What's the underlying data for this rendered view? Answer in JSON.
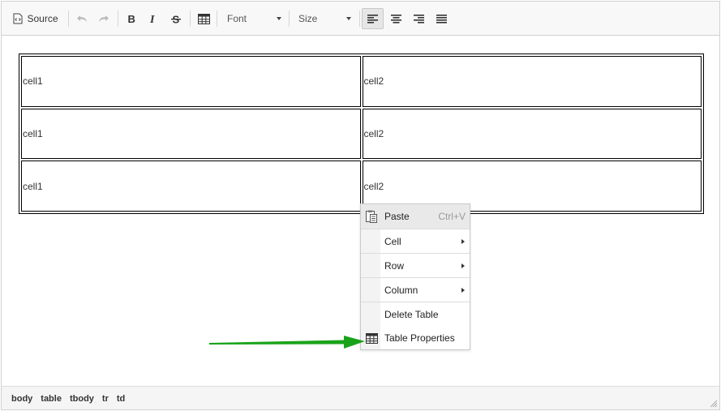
{
  "toolbar": {
    "source_label": "Source",
    "font_label": "Font",
    "size_label": "Size"
  },
  "table": {
    "rows": [
      [
        "cell1",
        "cell2"
      ],
      [
        "cell1",
        "cell2"
      ],
      [
        "cell1",
        "cell2"
      ]
    ]
  },
  "context_menu": {
    "paste_label": "Paste",
    "paste_shortcut": "Ctrl+V",
    "cell_label": "Cell",
    "row_label": "Row",
    "column_label": "Column",
    "delete_table_label": "Delete Table",
    "table_properties_label": "Table Properties"
  },
  "status_path": [
    "body",
    "table",
    "tbody",
    "tr",
    "td"
  ],
  "colors": {
    "arrow": "#1aa31a",
    "toolbar_bg": "#f8f8f8",
    "menu_hover": "#e9e9e9"
  }
}
